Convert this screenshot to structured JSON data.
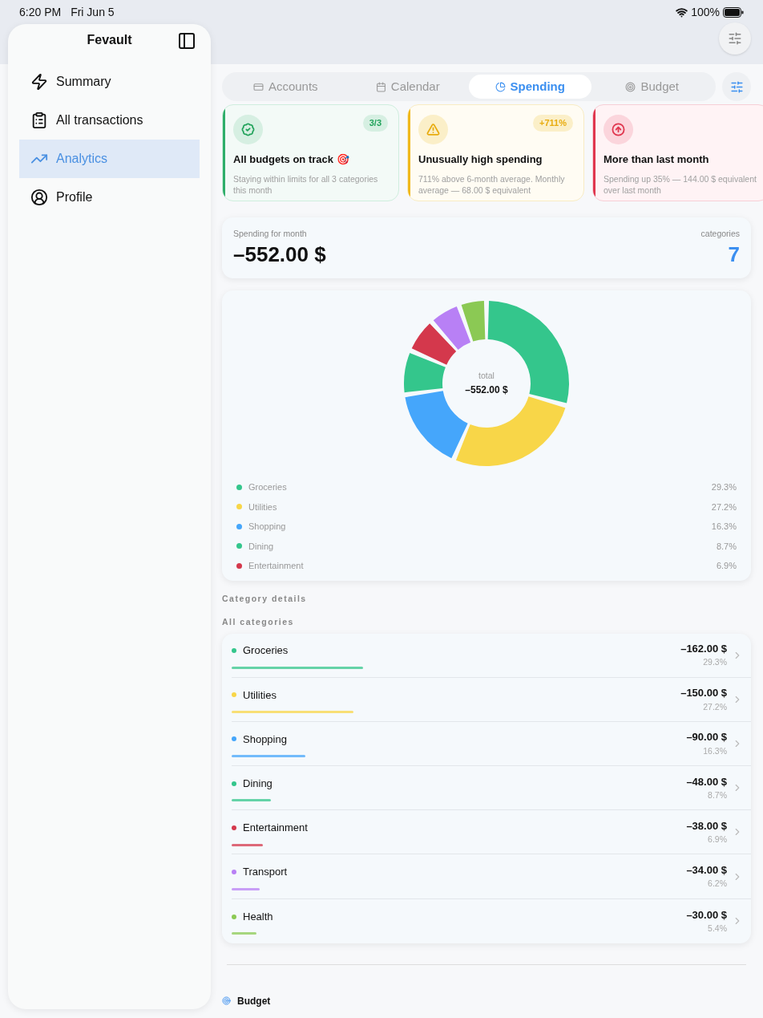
{
  "status_bar": {
    "time": "6:20 PM",
    "date": "Fri Jun 5",
    "battery": "100%"
  },
  "sidebar": {
    "title": "Fevault",
    "items": [
      {
        "label": "Summary",
        "selected": false
      },
      {
        "label": "All transactions",
        "selected": false
      },
      {
        "label": "Analytics",
        "selected": true
      },
      {
        "label": "Profile",
        "selected": false
      }
    ]
  },
  "tabs": [
    {
      "label": "Accounts",
      "selected": false
    },
    {
      "label": "Calendar",
      "selected": false
    },
    {
      "label": "Spending",
      "selected": true
    },
    {
      "label": "Budget",
      "selected": false
    }
  ],
  "insights": [
    {
      "kind": "success",
      "badge": "3/3",
      "title": "All budgets on track 🎯",
      "text": "Staying within limits for all 3 categories this month"
    },
    {
      "kind": "warning",
      "badge": "+711%",
      "title": "Unusually high spending",
      "text": "711% above 6-month average. Monthly average — 68.00 $ equivalent"
    },
    {
      "kind": "danger",
      "title": "More than last month",
      "text": "Spending up 35% — 144.00 $ equivalent over last month"
    }
  ],
  "summary": {
    "label": "Spending for month",
    "amount": "–552.00 $",
    "count_label": "categories",
    "count": "7"
  },
  "donut": {
    "center_label": "total",
    "center_value": "–552.00 $",
    "chart_data": {
      "type": "donut",
      "values": [
        29.3,
        27.2,
        16.3,
        8.7,
        6.9,
        6.2,
        5.4
      ],
      "colors": [
        "#34c68c",
        "#f8d648",
        "#45a6fb",
        "#34c68c",
        "#d4384c",
        "#b880f5",
        "#8bc954"
      ]
    },
    "legend": [
      {
        "label": "Groceries",
        "value": "29.3%",
        "color": "#34c68c"
      },
      {
        "label": "Utilities",
        "value": "27.2%",
        "color": "#f8d648"
      },
      {
        "label": "Shopping",
        "value": "16.3%",
        "color": "#45a6fb"
      },
      {
        "label": "Dining",
        "value": "8.7%",
        "color": "#34c68c"
      },
      {
        "label": "Entertainment",
        "value": "6.9%",
        "color": "#d4384c"
      }
    ]
  },
  "section_title": "Category details",
  "list_title": "All categories",
  "categories": [
    {
      "name": "Groceries",
      "amount": "–162.00 $",
      "percent": "29.3%",
      "level": 0.293,
      "color": "#34c68c"
    },
    {
      "name": "Utilities",
      "amount": "–150.00 $",
      "percent": "27.2%",
      "level": 0.272,
      "color": "#f8d648"
    },
    {
      "name": "Shopping",
      "amount": "–90.00 $",
      "percent": "16.3%",
      "level": 0.163,
      "color": "#45a6fb"
    },
    {
      "name": "Dining",
      "amount": "–48.00 $",
      "percent": "8.7%",
      "level": 0.087,
      "color": "#34c68c"
    },
    {
      "name": "Entertainment",
      "amount": "–38.00 $",
      "percent": "6.9%",
      "level": 0.069,
      "color": "#d4384c"
    },
    {
      "name": "Transport",
      "amount": "–34.00 $",
      "percent": "6.2%",
      "level": 0.062,
      "color": "#b880f5"
    },
    {
      "name": "Health",
      "amount": "–30.00 $",
      "percent": "5.4%",
      "level": 0.054,
      "color": "#8bc954"
    }
  ],
  "footer_section": {
    "title": "Budget"
  }
}
